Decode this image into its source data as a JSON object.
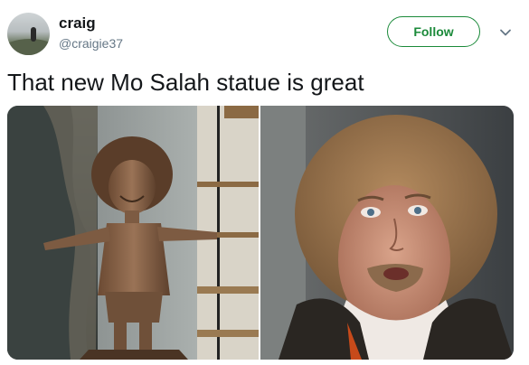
{
  "tweet": {
    "author": {
      "display_name": "craig",
      "handle": "@craigie37"
    },
    "follow_label": "Follow",
    "text": "That new Mo Salah statue is great",
    "media": [
      {
        "icon": "statue-photo"
      },
      {
        "icon": "man-photo"
      }
    ]
  },
  "colors": {
    "accent": "#1b8a3a",
    "text": "#14171a",
    "muted": "#657786"
  }
}
